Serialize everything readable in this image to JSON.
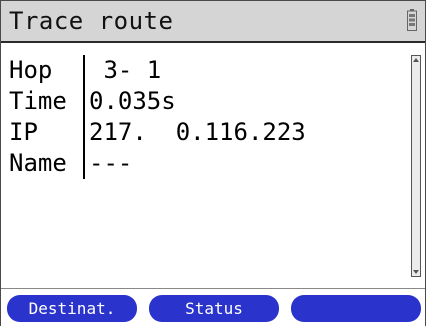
{
  "header": {
    "title": "Trace route",
    "battery_icon": "battery-icon"
  },
  "rows": [
    {
      "label": "Hop",
      "value": " 3- 1"
    },
    {
      "label": "Time",
      "value": "0.035s"
    },
    {
      "label": "IP",
      "value": "217.  0.116.223"
    },
    {
      "label": "Name",
      "value": "---"
    }
  ],
  "softkeys": [
    {
      "label": "Destinat."
    },
    {
      "label": "Status"
    },
    {
      "label": ""
    }
  ],
  "colors": {
    "softkey": "#2a33cc",
    "titlebar": "#d5d5d5"
  }
}
